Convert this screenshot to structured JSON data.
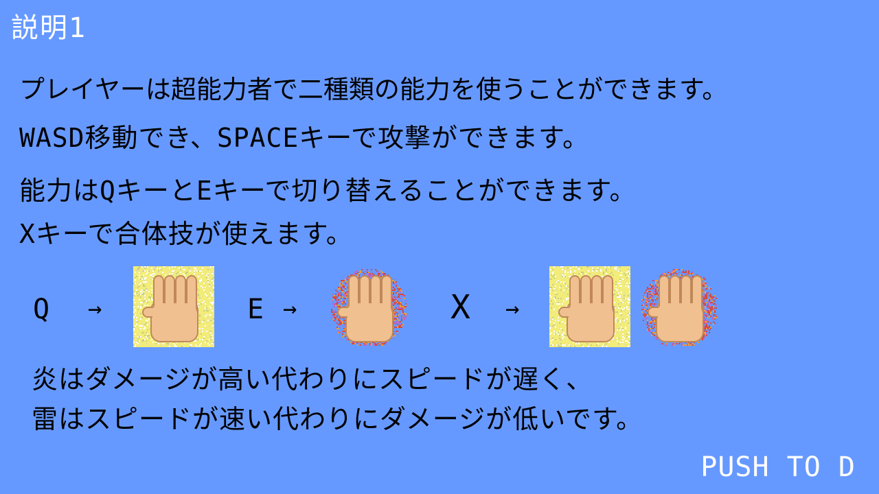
{
  "title": "説明1",
  "lines": [
    "プレイヤーは超能力者で二種類の能力を使うことができます。",
    "WASD移動でき、SPACEキーで攻撃ができます。",
    "能力はQキーとEキーで切り替えることができます。",
    "Xキーで合体技が使えます。",
    "炎はダメージが高い代わりにスピードが遅く、",
    "雷はスピードが速い代わりにダメージが低いです。"
  ],
  "legend": {
    "q_key": "Q",
    "e_key": "E",
    "x_key": "X",
    "arrow": "→",
    "hands": [
      {
        "name": "lightning-hand",
        "aura": "lightning"
      },
      {
        "name": "fire-hand",
        "aura": "fire"
      },
      {
        "name": "combo-lightning-hand",
        "aura": "lightning"
      },
      {
        "name": "combo-fire-hand",
        "aura": "fire"
      }
    ]
  },
  "prompt": "PUSH TO D",
  "colors": {
    "background": "#6699ff",
    "lightning": "#f2ec7a",
    "fire": "#d8483c",
    "skin": "#f0c090"
  }
}
